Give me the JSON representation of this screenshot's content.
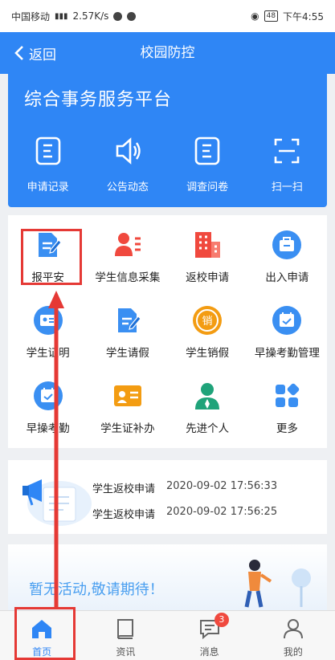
{
  "status_bar": {
    "carrier": "中国移动",
    "speed": "2.57K/s",
    "battery": "48",
    "time": "下午4:55"
  },
  "nav": {
    "back_label": "返回",
    "title": "校园防控"
  },
  "hero": {
    "title": "综合事务服务平台",
    "quick_actions": [
      {
        "label": "申请记录",
        "icon": "record-icon"
      },
      {
        "label": "公告动态",
        "icon": "speaker-icon"
      },
      {
        "label": "调查问卷",
        "icon": "survey-icon"
      },
      {
        "label": "扫一扫",
        "icon": "scan-icon"
      }
    ]
  },
  "services": [
    {
      "label": "报平安",
      "icon": "report-safety-icon"
    },
    {
      "label": "学生信息采集",
      "icon": "student-info-icon"
    },
    {
      "label": "返校申请",
      "icon": "building-icon"
    },
    {
      "label": "出入申请",
      "icon": "briefcase-icon"
    },
    {
      "label": "学生证明",
      "icon": "id-card-icon"
    },
    {
      "label": "学生请假",
      "icon": "leave-doc-icon"
    },
    {
      "label": "学生销假",
      "icon": "cancel-leave-icon"
    },
    {
      "label": "早操考勤管理",
      "icon": "calendar-check-icon"
    },
    {
      "label": "早操考勤",
      "icon": "calendar-check-icon"
    },
    {
      "label": "学生证补办",
      "icon": "student-card-icon"
    },
    {
      "label": "先进个人",
      "icon": "person-icon"
    },
    {
      "label": "更多",
      "icon": "more-icon"
    }
  ],
  "notices": [
    {
      "title": "学生返校申请",
      "time": "2020-09-02 17:56:33"
    },
    {
      "title": "学生返校申请",
      "time": "2020-09-02 17:56:25"
    }
  ],
  "activity": {
    "text": "暂无活动,敬请期待！"
  },
  "tabbar": [
    {
      "label": "首页",
      "icon": "home-icon",
      "active": true
    },
    {
      "label": "资讯",
      "icon": "book-icon"
    },
    {
      "label": "消息",
      "icon": "message-icon",
      "badge": "3"
    },
    {
      "label": "我的",
      "icon": "user-icon"
    }
  ],
  "colors": {
    "primary": "#2f86f5",
    "highlight": "#e53935",
    "badge": "#f0493e"
  }
}
